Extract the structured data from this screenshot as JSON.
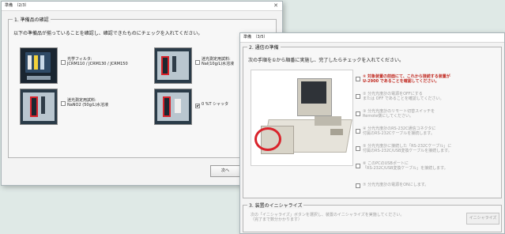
{
  "window1": {
    "title": "準備　（2/3）",
    "section": {
      "title": "1. 準備品の確認",
      "instruction": "以下の準備品が揃っていることを確認し、確認できたものにチェックを入れてください。",
      "items": [
        {
          "line1": "光学フィルタ:",
          "line2": "JCRM110 / JCRM130 / JCRM150",
          "checked": false
        },
        {
          "line1": "迷光測定用試料:",
          "line2": "NaI(10g/L)水溶液",
          "checked": false
        },
        {
          "line1": "迷光測定用試料:",
          "line2": "NaNO2 (50g/L)水溶液",
          "checked": false
        },
        {
          "line1": "0 %T シャッタ",
          "line2": "",
          "checked": true
        }
      ]
    },
    "next_button": "次へ"
  },
  "window2": {
    "title": "準備　（3/5）",
    "section2": {
      "title": "2. 通信の準備",
      "instruction": "次の手順を①から順番に実施し、完了したらチェックを入れてください。",
      "steps": [
        {
          "line1": "① 対象装置の前面にて、これから接続する装置が",
          "line2": "U-2900 であることを確認してください。",
          "state": "active"
        },
        {
          "line1": "② 分光光度計の電源をOFFにする",
          "line2": "または OFF であることを確認してください。",
          "state": "inactive"
        },
        {
          "line1": "③ 分光光度計のリモート切替スイッチを",
          "line2": "Remote側にしてください。",
          "state": "inactive"
        },
        {
          "line1": "④ 分光光度計のRS-232C通信コネクタに",
          "line2": "付属のRS-232Cケーブルを接続します。",
          "state": "inactive"
        },
        {
          "line1": "⑤ 分光光度計に接続した「RS-232Cケーブル」に",
          "line2": "付属のRS-232C/USB変換ケーブルを接続します。",
          "state": "inactive"
        },
        {
          "line1": "⑥ このPCのUSBポートに",
          "line2": "「RS-232C/USB変換ケーブル」を接続します。",
          "state": "inactive"
        },
        {
          "line1": "⑦ 分光光度計の電源をONにします。",
          "line2": "",
          "state": "inactive"
        }
      ]
    },
    "section3": {
      "title": "3. 装置のイニシャライズ",
      "line1": "次の「イニシャライズ」ボタンを選択し、装置のイニシャライズを実施してください。",
      "line2": "（完了まで数分かかります）",
      "button": "イニシャライズ"
    }
  },
  "colors": {
    "highlight_red": "#d9232b",
    "step_active": "#c0261d",
    "disabled_text": "#9c9c9c"
  }
}
